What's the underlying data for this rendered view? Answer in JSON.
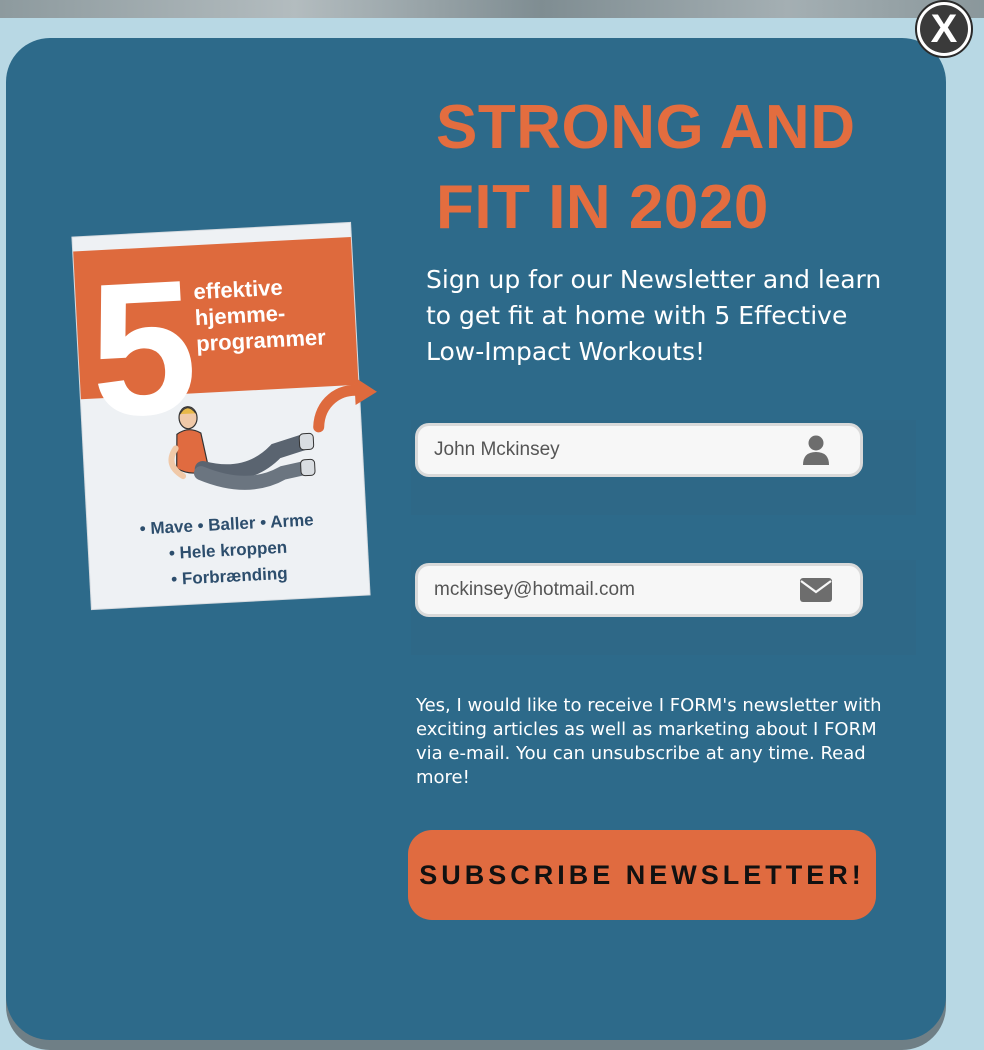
{
  "popup": {
    "close_label": "X",
    "headline_line1": "STRONG AND",
    "headline_line2": "FIT IN 2020",
    "subtitle": "Sign up for our Newsletter and learn to get fit at home with 5 Effective Low-Impact Workouts!",
    "name_field": {
      "value": "John Mckinsey",
      "icon": "user-icon"
    },
    "email_field": {
      "value": "mckinsey@hotmail.com",
      "icon": "envelope-icon"
    },
    "consent_text": "Yes, I would like to receive I FORM's newsletter with exciting articles as well as marketing about I FORM via e-mail. You can unsubscribe at any time. Read more!",
    "subscribe_label": "SUBSCRIBE NEWSLETTER!"
  },
  "book": {
    "number": "5",
    "title_line1": "effektive",
    "title_line2": "hjemme-",
    "title_line3": "programmer",
    "bullets_row1": "• Mave  • Baller  • Arme",
    "bullets_row2": "• Hele kroppen",
    "bullets_row3": "• Forbrænding"
  },
  "colors": {
    "modal_bg": "#2d6a8a",
    "accent_orange": "#e36d3f",
    "page_bg": "#b8d8e4"
  }
}
